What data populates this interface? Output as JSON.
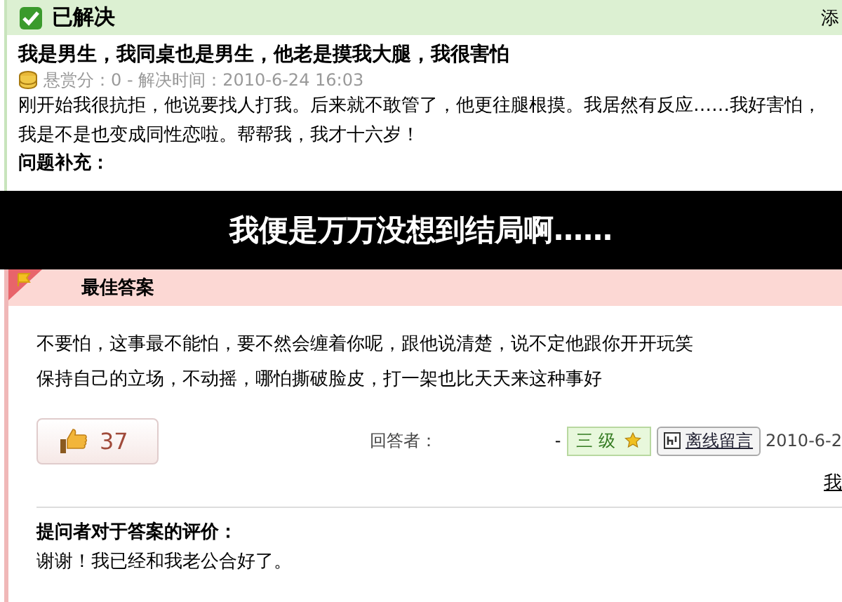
{
  "question": {
    "status": "已解决",
    "corner_text": "添",
    "title": "我是男生，我同桌也是男生，他老是摸我大腿，我很害怕",
    "meta": "悬赏分：0 - 解决时间：2010-6-24 16:03",
    "body": "刚开始我很抗拒，他说要找人打我。后来就不敢管了，他更往腿根摸。我居然有反应……我好害怕，我是不是也变成同性恋啦。帮帮我，我才十六岁！",
    "supplement_label": "问题补充："
  },
  "caption": "我便是万万没想到结局啊……",
  "best_answer": {
    "heading": "最佳答案",
    "lines": [
      "不要怕，这事最不能怕，要不然会缠着你呢，跟他说清楚，说不定他跟你开开玩笑",
      "保持自己的立场，不动摇，哪怕撕破脸皮，打一架也比天天来这种事好"
    ],
    "likes": "37",
    "answerer_label": "回答者：",
    "separator": "-",
    "level": "三 级",
    "message_button": "离线留言",
    "date": "2010-6-2",
    "link": "我"
  },
  "evaluation": {
    "heading": "提问者对于答案的评价：",
    "text": "谢谢！我已经和我老公合好了。"
  }
}
